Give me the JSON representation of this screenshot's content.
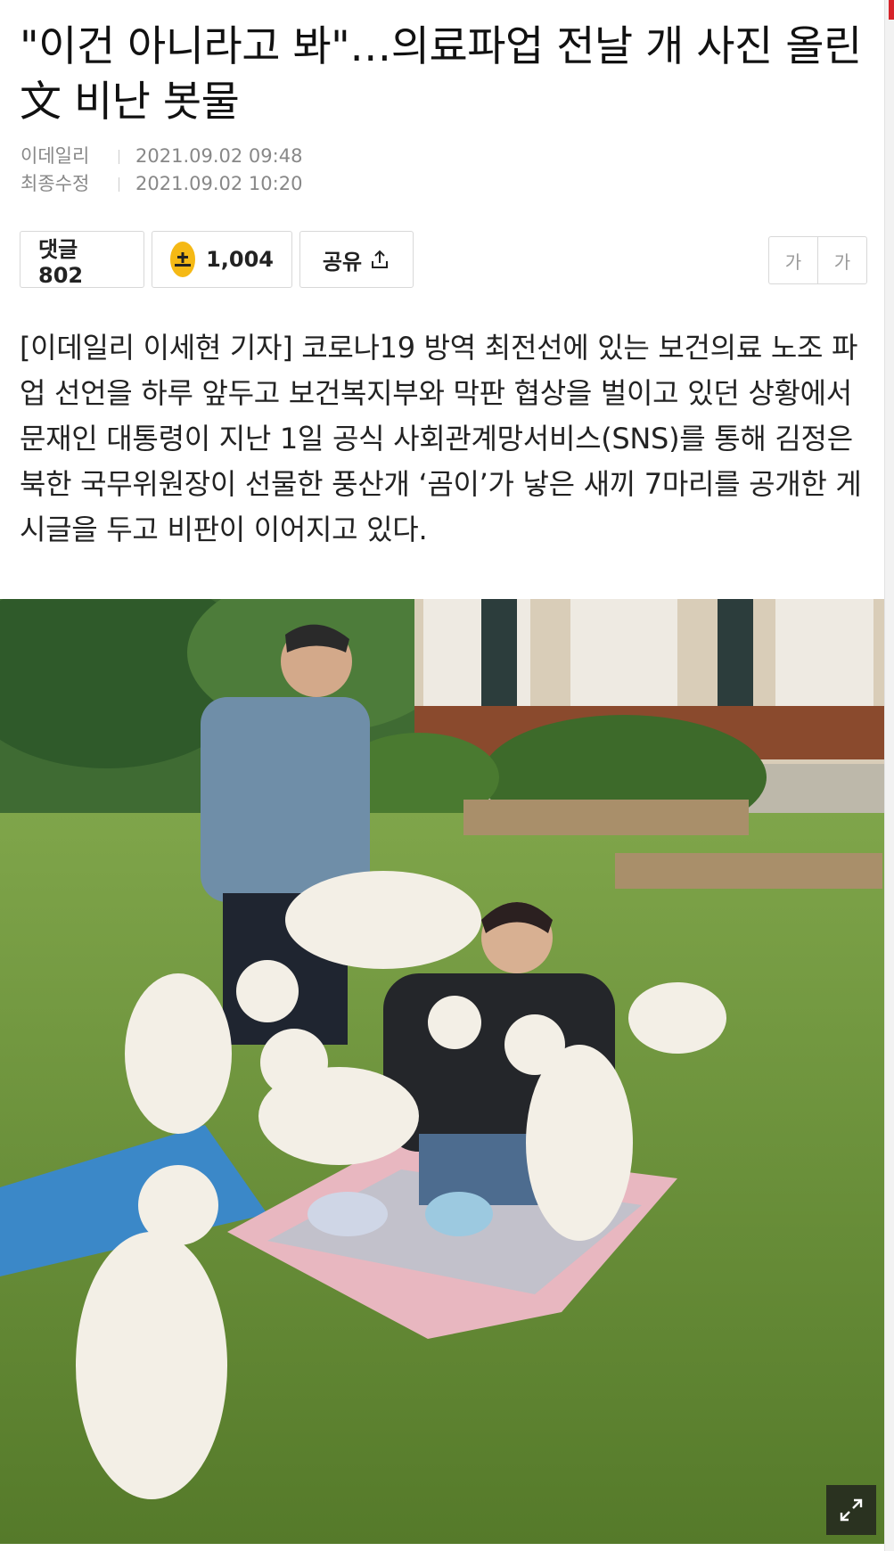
{
  "article": {
    "headline": "\"이건 아니라고 봐\"…의료파업 전날 개 사진 올린 文 비난 봇물",
    "meta": [
      {
        "label": "이데일리",
        "value": "2021.09.02 09:48"
      },
      {
        "label": "최종수정",
        "value": "2021.09.02 10:20"
      }
    ],
    "actions": {
      "comment_label": "댓글 802",
      "coin_count": "1,004",
      "share_label": "공유"
    },
    "font_size_buttons": [
      "가",
      "가"
    ],
    "body": "[이데일리 이세현 기자] 코로나19 방역 최전선에 있는 보건의료 노조 파업 선언을 하루 앞두고 보건복지부와 막판 협상을 벌이고 있던 상황에서 문재인 대통령이 지난 1일 공식 사회관계망서비스(SNS)를 통해 김정은 북한 국무위원장이 선물한 풍산개 ‘곰이’가 낳은 새끼 7마리를 공개한 게시글을 두고 비판이 이어지고 있다."
  },
  "icons": {
    "coin": "coin-icon",
    "share": "share-upload-icon",
    "expand": "expand-icon"
  },
  "colors": {
    "coin": "#f5b915",
    "accent_red": "#d6242a",
    "meta_text": "#888888"
  }
}
